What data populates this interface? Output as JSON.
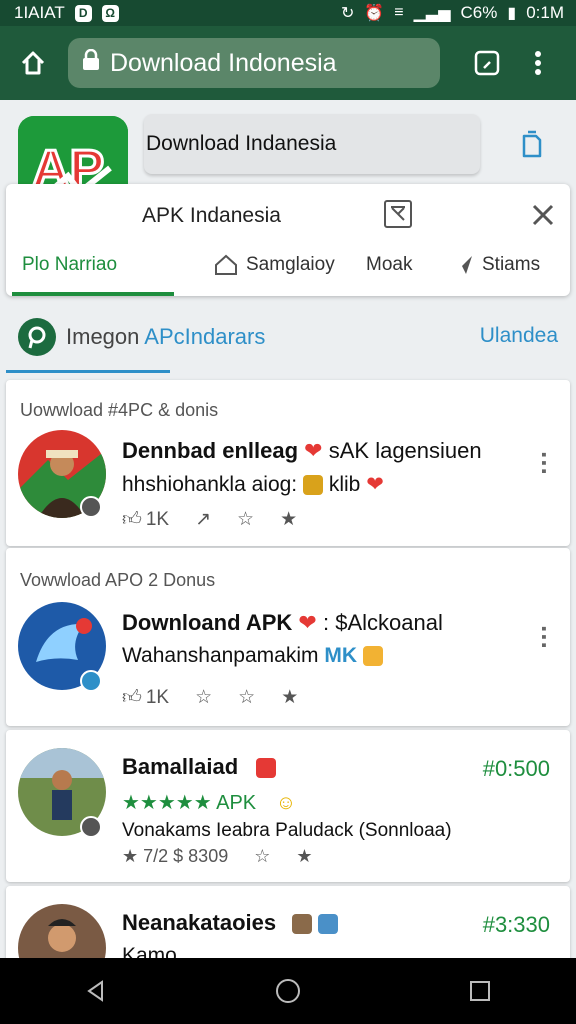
{
  "status_bar": {
    "time_left": "1IAIAT",
    "battery": "C6%",
    "time_right": "0:1M",
    "color": "#174a31"
  },
  "browser": {
    "url_text": "Download Indonesia",
    "toolbar_color": "#1f5a3b"
  },
  "app_header": {
    "search_value": "Download Indanesia",
    "app_name": "APK Indanesia",
    "icon_text": "AP",
    "accent": "#1e8e3e"
  },
  "tabs": [
    {
      "label": "Plo Narriao",
      "icon": ""
    },
    {
      "label": "Samglaioy",
      "icon": "home-outline-icon"
    },
    {
      "label": "Moak",
      "icon": ""
    },
    {
      "label": "Stiams",
      "icon": "send-icon"
    }
  ],
  "section": {
    "title_part1": "Imegon",
    "title_part2": "APcIndarars",
    "link": "Ulandea"
  },
  "posts": [
    {
      "source": "Uowwload #4PC & donis",
      "title": "Dennbad enlleag",
      "title_tail": "sAK lagensiuen",
      "subtitle": "hhshiohankla aiog:",
      "subtitle_tail": "klib",
      "likes": "1K"
    },
    {
      "source": "Vowwload APO 2 Donus",
      "title": "Downloand APK",
      "title_tail": ": $Alckoanal",
      "subtitle": "Wahanshanpamakim",
      "subtitle_tail": "MK",
      "likes": "1K"
    },
    {
      "title": "Bamallaiad",
      "price": "#0:500",
      "rating_text": "APK",
      "description": "Vonakams Ieabra Paludack (Sonnloaa)",
      "meta": "★ 7/2 $ 8309"
    },
    {
      "title": "Neanakataoies",
      "price": "#3:330",
      "description": "Kamo"
    }
  ]
}
